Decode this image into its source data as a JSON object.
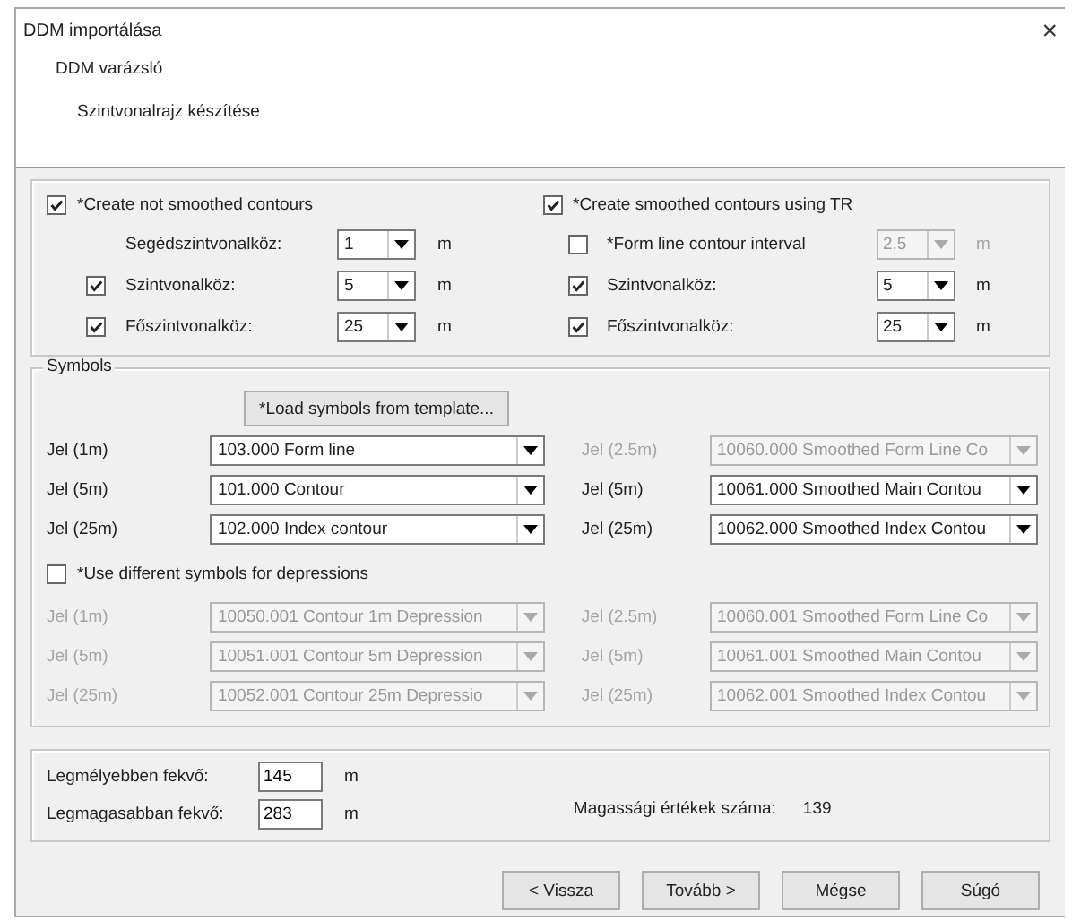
{
  "window": {
    "title": "DDM importálása",
    "close": "×"
  },
  "header": {
    "title": "DDM varázsló",
    "subtitle": "Szintvonalrajz készítése"
  },
  "contours": [
    {
      "title": "*Create not smoothed contours",
      "checked": true,
      "rows": [
        {
          "kind": "plain",
          "label": "Segédszintvonalköz:",
          "value": "1",
          "unit": "m",
          "disabled": false
        },
        {
          "kind": "check",
          "label": "Szintvonalköz:",
          "checked": true,
          "value": "5",
          "unit": "m",
          "disabled": false
        },
        {
          "kind": "check",
          "label": "Főszintvonalköz:",
          "checked": true,
          "value": "25",
          "unit": "m",
          "disabled": false
        }
      ]
    },
    {
      "title": "*Create smoothed contours using TR",
      "checked": true,
      "rows": [
        {
          "kind": "check",
          "label": "*Form line contour interval",
          "checked": false,
          "value": "2.5",
          "unit": "m",
          "disabled": true
        },
        {
          "kind": "check",
          "label": "Szintvonalköz:",
          "checked": true,
          "value": "5",
          "unit": "m",
          "disabled": false
        },
        {
          "kind": "check",
          "label": "Főszintvonalköz:",
          "checked": true,
          "value": "25",
          "unit": "m",
          "disabled": false
        }
      ]
    }
  ],
  "symbols": {
    "title": "Symbols",
    "load_button": "*Load symbols from template...",
    "rows": [
      [
        {
          "label": "Jel (1m)",
          "value": "103.000 Form line",
          "disabled": false
        },
        {
          "label": "Jel (2.5m)",
          "value": "10060.000 Smoothed Form Line Co",
          "disabled": true
        }
      ],
      [
        {
          "label": "Jel (5m)",
          "value": "101.000 Contour",
          "disabled": false
        },
        {
          "label": "Jel (5m)",
          "value": "10061.000 Smoothed Main Contou",
          "disabled": false
        }
      ],
      [
        {
          "label": "Jel (25m)",
          "value": "102.000 Index contour",
          "disabled": false
        },
        {
          "label": "Jel (25m)",
          "value": "10062.000 Smoothed Index Contou",
          "disabled": false
        }
      ]
    ],
    "depressions": {
      "label": "*Use different symbols for depressions",
      "checked": false
    },
    "depression_rows": [
      [
        {
          "label": "Jel (1m)",
          "value": "10050.001 Contour 1m Depression",
          "disabled": true
        },
        {
          "label": "Jel (2.5m)",
          "value": "10060.001 Smoothed Form Line Co",
          "disabled": true
        }
      ],
      [
        {
          "label": "Jel (5m)",
          "value": "10051.001 Contour 5m Depression",
          "disabled": true
        },
        {
          "label": "Jel (5m)",
          "value": "10061.001 Smoothed Main Contou",
          "disabled": true
        }
      ],
      [
        {
          "label": "Jel (25m)",
          "value": "10052.001 Contour 25m Depressio",
          "disabled": true
        },
        {
          "label": "Jel (25m)",
          "value": "10062.001 Smoothed Index Contou",
          "disabled": true
        }
      ]
    ]
  },
  "heights": {
    "rows": [
      {
        "label": "Legmélyebben fekvő:",
        "value": "145",
        "unit": "m"
      },
      {
        "label": "Legmagasabban fekvő:",
        "value": "283",
        "unit": "m"
      }
    ],
    "count_label": "Magassági értékek száma:",
    "count": "139"
  },
  "buttons": [
    "< Vissza",
    "Tovább >",
    "Mégse",
    "Súgó"
  ]
}
